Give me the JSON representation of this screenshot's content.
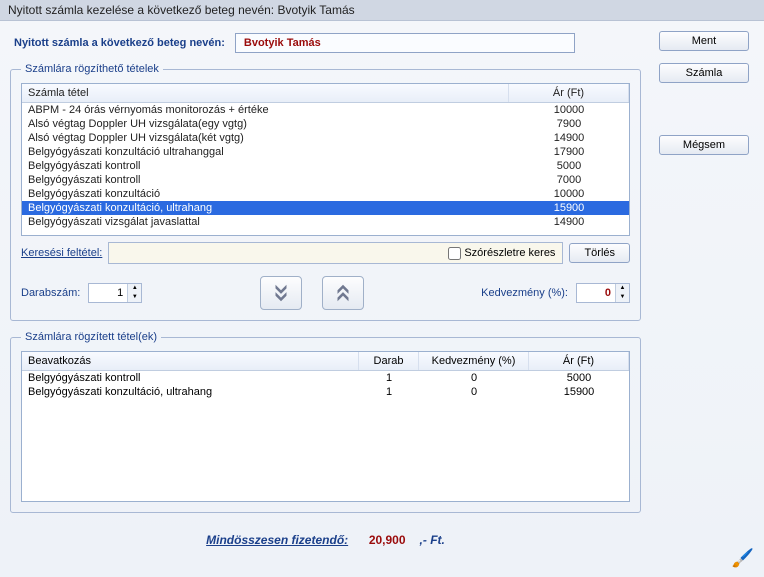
{
  "window": {
    "title": "Nyitott számla kezelése a következő beteg nevén: Bvotyik Tamás"
  },
  "patient": {
    "label": "Nyitott számla a következő beteg nevén:",
    "name": "Bvotyik Tamás"
  },
  "buttons": {
    "save": "Ment",
    "invoice": "Számla",
    "cancel": "Mégsem",
    "delete": "Törlés"
  },
  "fieldset1": {
    "legend": "Számlára rögzíthető tételek"
  },
  "table1": {
    "header_name": "Számla tétel",
    "header_price": "Ár (Ft)",
    "rows": [
      {
        "name": "ABPM - 24 órás vérnyomás monitorozás + értéke",
        "price": "10000"
      },
      {
        "name": "Alsó végtag Doppler UH vizsgálata(egy vgtg)",
        "price": "7900"
      },
      {
        "name": "Alsó végtag Doppler UH vizsgálata(két vgtg)",
        "price": "14900"
      },
      {
        "name": "Belgyógyászati  konzultáció ultrahanggal",
        "price": "17900"
      },
      {
        "name": "Belgyógyászati kontroll",
        "price": "5000"
      },
      {
        "name": "Belgyógyászati kontroll",
        "price": "7000"
      },
      {
        "name": "Belgyógyászati konzultáció",
        "price": "10000"
      },
      {
        "name": "Belgyógyászati konzultáció, ultrahang",
        "price": "15900"
      },
      {
        "name": "Belgyógyászati vizsgálat javaslattal",
        "price": "14900"
      }
    ],
    "selected_index": 7
  },
  "search": {
    "label": "Keresési feltétel:",
    "value": "",
    "checkbox_label": "Szórészletre keres"
  },
  "qty": {
    "label": "Darabszám:",
    "value": "1"
  },
  "discount": {
    "label": "Kedvezmény (%):",
    "value": "0"
  },
  "fieldset2": {
    "legend": "Számlára rögzített tétel(ek)"
  },
  "table2": {
    "header_name": "Beavatkozás",
    "header_qty": "Darab",
    "header_disc": "Kedvezmény (%)",
    "header_price": "Ár (Ft)",
    "rows": [
      {
        "name": "Belgyógyászati kontroll",
        "qty": "1",
        "disc": "0",
        "price": "5000"
      },
      {
        "name": "Belgyógyászati konzultáció, ultrahang",
        "qty": "1",
        "disc": "0",
        "price": "15900"
      }
    ]
  },
  "total": {
    "label": "Mindösszesen fizetendő:",
    "amount": "20,900",
    "suffix": ",- Ft."
  }
}
